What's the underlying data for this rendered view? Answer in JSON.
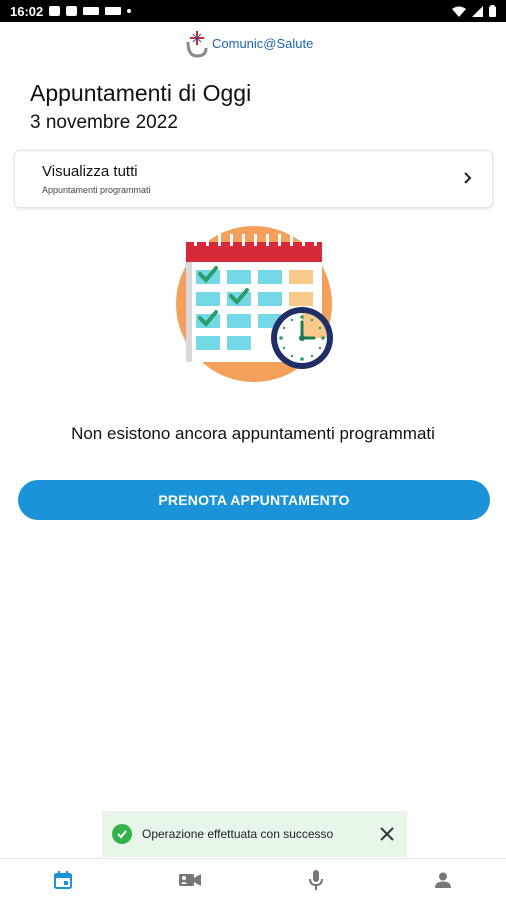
{
  "status_bar": {
    "time": "16:02"
  },
  "logo": {
    "text": "Comunic@Salute"
  },
  "header": {
    "title": "Appuntamenti di Oggi",
    "date": "3 novembre 2022"
  },
  "view_all_card": {
    "title": "Visualizza tutti",
    "subtitle": "Appuntamenti programmati"
  },
  "empty_state": {
    "message": "Non esistono ancora appuntamenti programmati"
  },
  "book_button": {
    "label": "PRENOTA APPUNTAMENTO"
  },
  "toast": {
    "message": "Operazione effettuata con successo"
  },
  "bottom_nav": [
    {
      "icon": "calendar-icon",
      "active": true
    },
    {
      "icon": "video-camera-icon",
      "active": false
    },
    {
      "icon": "microphone-icon",
      "active": false
    },
    {
      "icon": "person-icon",
      "active": false
    }
  ],
  "colors": {
    "accent": "#1a93d8",
    "logo_blue": "#1e63b3",
    "toast_bg": "#e8f6ea",
    "success": "#33b24a",
    "nav_active": "#1a93d8",
    "nav_inactive": "#777777"
  }
}
